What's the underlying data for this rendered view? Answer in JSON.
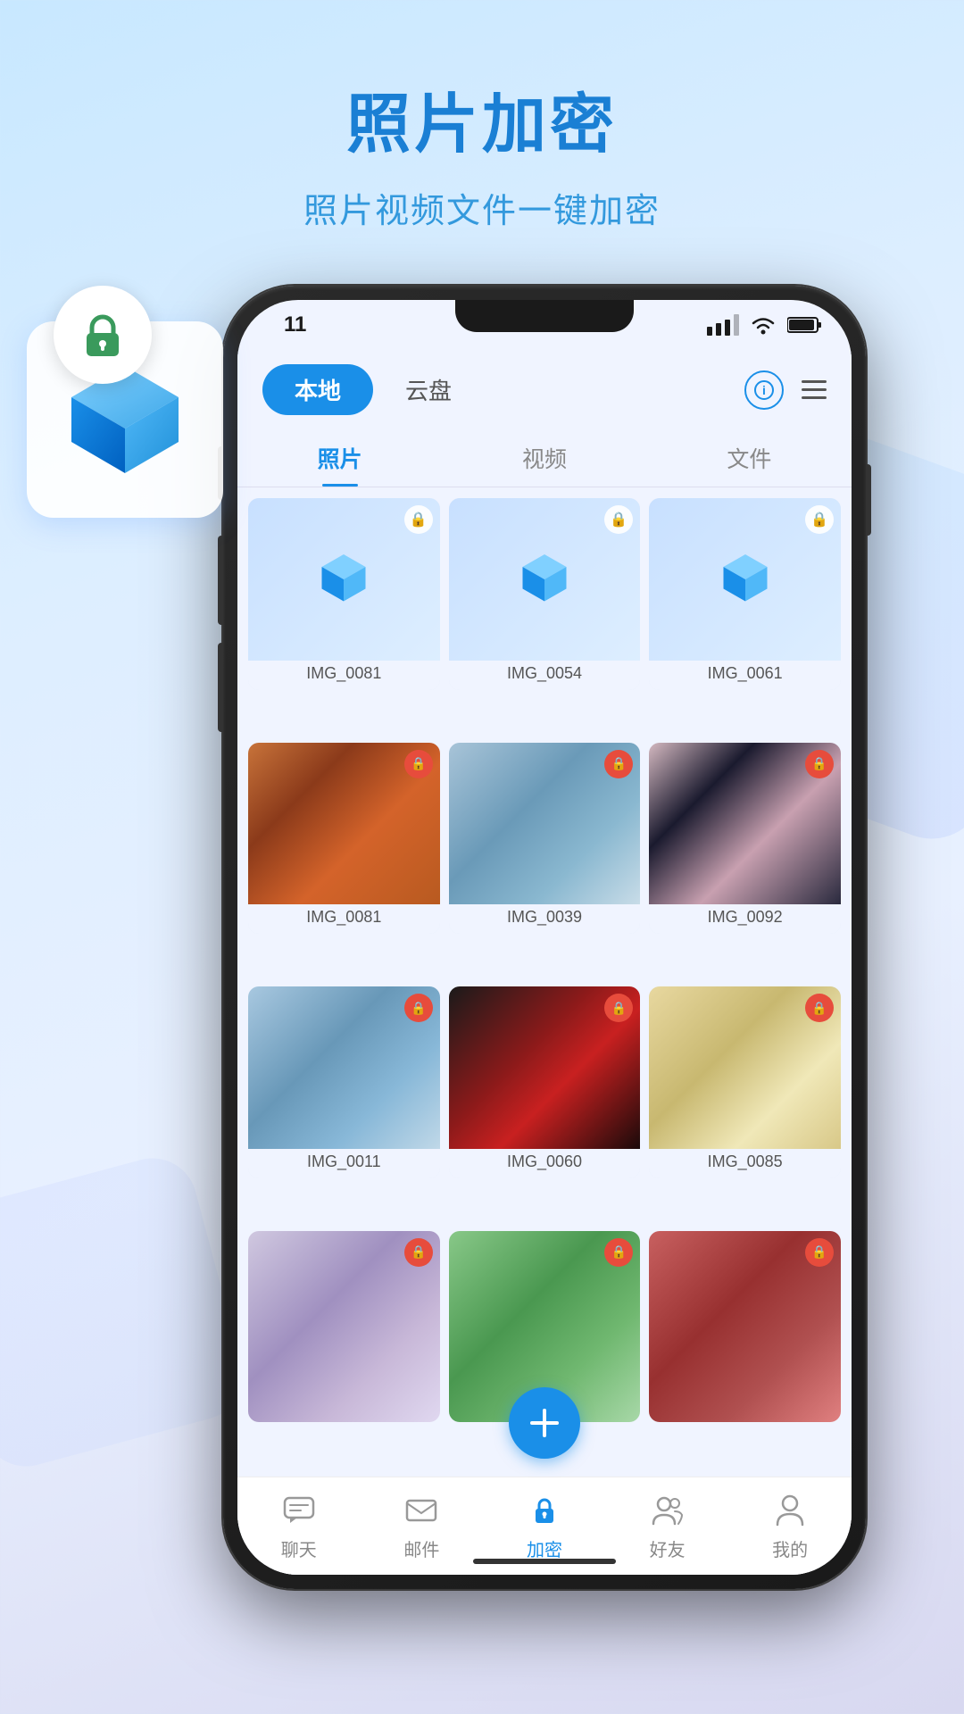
{
  "background": {
    "gradient_start": "#c8e8ff",
    "gradient_end": "#d8d8f0"
  },
  "title_section": {
    "main_title": "照片加密",
    "subtitle": "照片视频文件一键加密"
  },
  "phone": {
    "status_bar": {
      "time": "11",
      "signal": "▐▐▐▌",
      "wifi": "wifi",
      "battery": "battery"
    },
    "top_tabs": {
      "local_label": "本地",
      "cloud_label": "云盘"
    },
    "sub_tabs": [
      {
        "label": "照片",
        "active": true
      },
      {
        "label": "视频",
        "active": false
      },
      {
        "label": "文件",
        "active": false
      }
    ],
    "photos": [
      {
        "name": "IMG_0081",
        "type": "encrypted",
        "lock_color": "green"
      },
      {
        "name": "IMG_0054",
        "type": "encrypted",
        "lock_color": "green"
      },
      {
        "name": "IMG_0061",
        "type": "encrypted",
        "lock_color": "green"
      },
      {
        "name": "IMG_0081",
        "type": "real",
        "photo_class": "photo-red-dress",
        "lock_color": "red"
      },
      {
        "name": "IMG_0039",
        "type": "real",
        "photo_class": "photo-blue-jacket",
        "lock_color": "red"
      },
      {
        "name": "IMG_0092",
        "type": "real",
        "photo_class": "photo-black-dress",
        "lock_color": "red"
      },
      {
        "name": "IMG_0011",
        "type": "real",
        "photo_class": "photo-umbrella",
        "lock_color": "red"
      },
      {
        "name": "IMG_0060",
        "type": "real",
        "photo_class": "photo-red-hanfu",
        "lock_color": "red"
      },
      {
        "name": "IMG_0085",
        "type": "real",
        "photo_class": "photo-white-dress",
        "lock_color": "red"
      },
      {
        "name": "",
        "type": "real",
        "photo_class": "photo-crown-girl",
        "lock_color": "red"
      },
      {
        "name": "",
        "type": "real",
        "photo_class": "photo-green-partial",
        "lock_color": "red"
      },
      {
        "name": "",
        "type": "real",
        "photo_class": "photo-red-partial",
        "lock_color": "red"
      }
    ],
    "bottom_nav": [
      {
        "label": "聊天",
        "icon": "chat-icon",
        "active": false
      },
      {
        "label": "邮件",
        "icon": "mail-icon",
        "active": false
      },
      {
        "label": "加密",
        "icon": "lock-key-icon",
        "active": true
      },
      {
        "label": "好友",
        "icon": "friends-icon",
        "active": false
      },
      {
        "label": "我的",
        "icon": "profile-icon",
        "active": false
      }
    ],
    "fab": {
      "label": "+"
    }
  }
}
